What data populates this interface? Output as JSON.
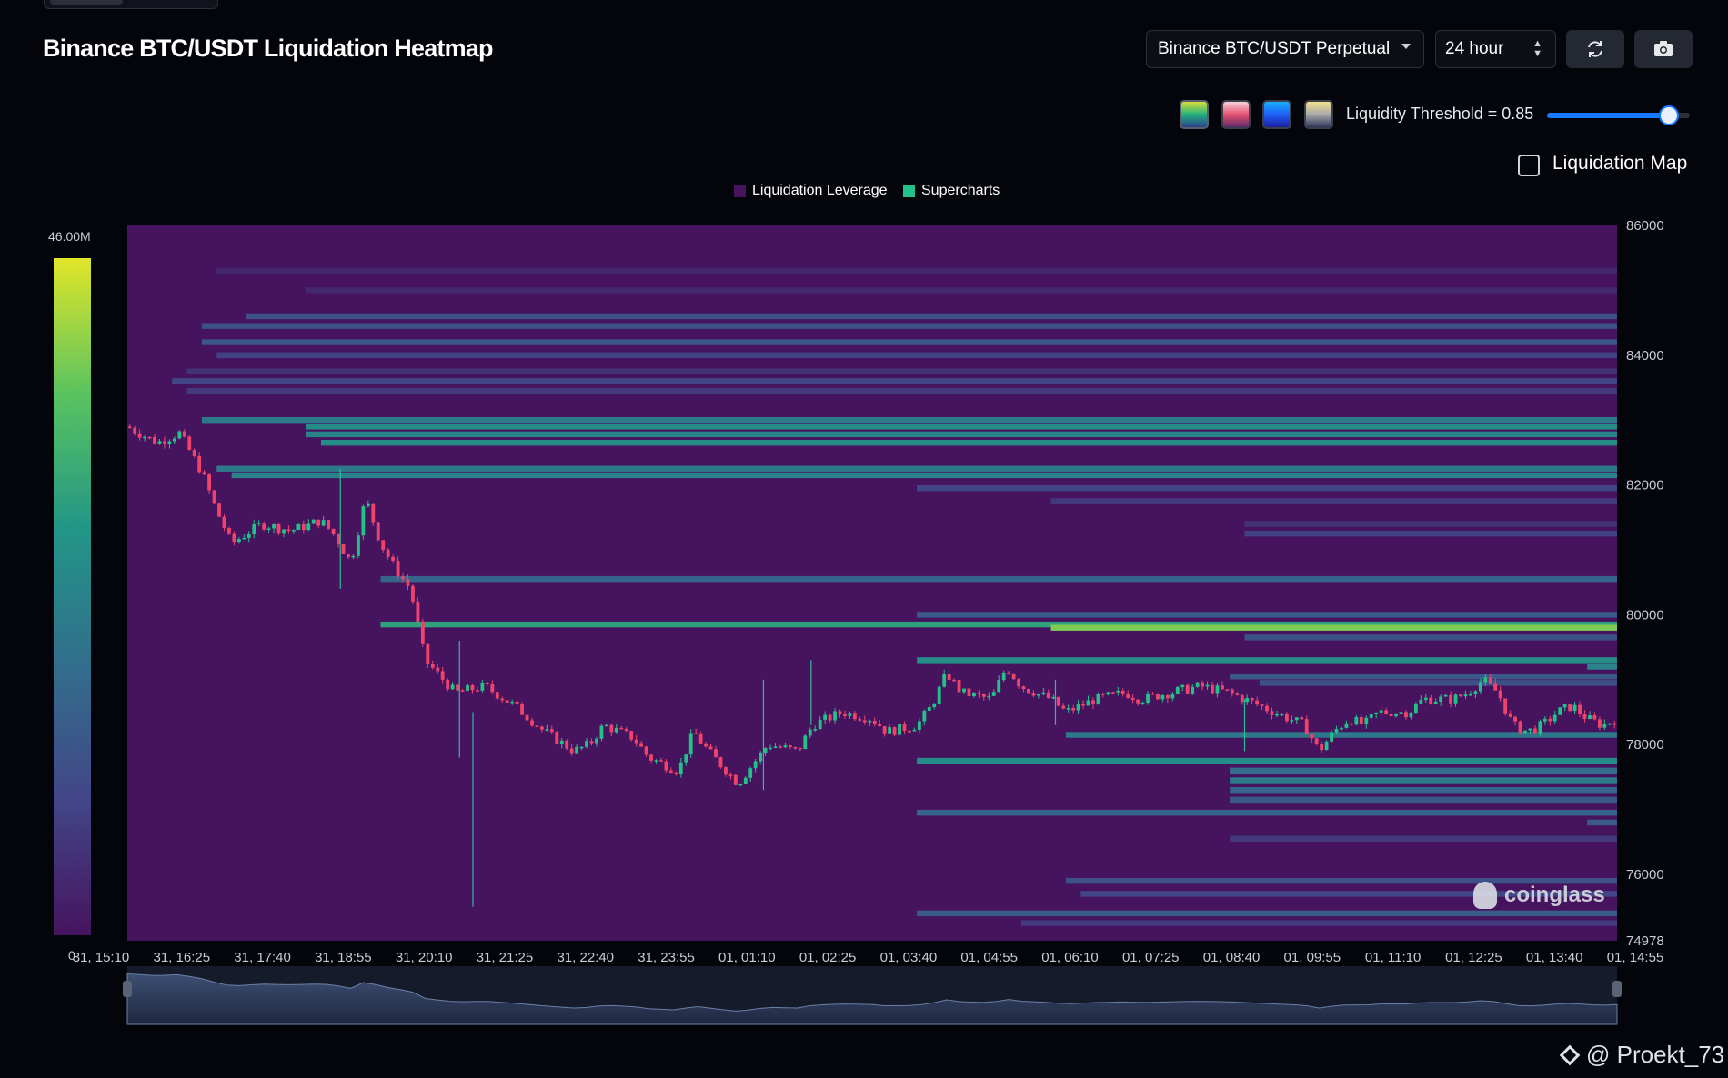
{
  "page": {
    "title": "Binance BTC/USDT Liquidation Heatmap"
  },
  "controls": {
    "pair_select": "Binance BTC/USDT Perpetual",
    "range_select": "24 hour",
    "refresh_icon": "refresh-icon",
    "camera_icon": "camera-icon",
    "threshold_label": "Liquidity Threshold = 0.85",
    "threshold_value": 0.85,
    "liquidation_map_label": "Liquidation Map",
    "liquidation_map_checked": false,
    "palettes": [
      "viridis",
      "pink",
      "blue",
      "yellow-gray"
    ]
  },
  "legend": {
    "item1": "Liquidation Leverage",
    "item2": "Supercharts"
  },
  "colorbar": {
    "max_label": "46.00M",
    "min_label": "0"
  },
  "watermark": "coinglass",
  "credit": "@ Proekt_73",
  "colors": {
    "background": "#03050b",
    "heatmap_base": "#46145f",
    "candle_up": "#23c18a",
    "candle_down": "#f0436b",
    "accent": "#1677ff"
  },
  "chart_data": {
    "type": "heatmap",
    "title": "Binance BTC/USDT Liquidation Heatmap",
    "y_axis": {
      "min": 74978,
      "max": 86000,
      "ticks": [
        86000,
        84000,
        82000,
        80000,
        78000,
        76000
      ],
      "bottom_label": "74978"
    },
    "x_axis": {
      "ticks": [
        "31, 15:10",
        "31, 16:25",
        "31, 17:40",
        "31, 18:55",
        "31, 20:10",
        "31, 21:25",
        "31, 22:40",
        "31, 23:55",
        "01, 01:10",
        "01, 02:25",
        "01, 03:40",
        "01, 04:55",
        "01, 06:10",
        "01, 07:25",
        "01, 08:40",
        "01, 09:55",
        "01, 11:10",
        "01, 12:25",
        "01, 13:40",
        "01, 14:55"
      ]
    },
    "colorbar_range": [
      0,
      46000000
    ],
    "liquidation_bands": [
      {
        "price": 85300,
        "start": 0.06,
        "intensity": 0.08
      },
      {
        "price": 85000,
        "start": 0.12,
        "intensity": 0.08
      },
      {
        "price": 84600,
        "start": 0.08,
        "intensity": 0.25
      },
      {
        "price": 84450,
        "start": 0.05,
        "intensity": 0.25
      },
      {
        "price": 84200,
        "start": 0.05,
        "intensity": 0.28
      },
      {
        "price": 84000,
        "start": 0.06,
        "intensity": 0.18
      },
      {
        "price": 83750,
        "start": 0.04,
        "intensity": 0.12
      },
      {
        "price": 83600,
        "start": 0.03,
        "intensity": 0.2
      },
      {
        "price": 83450,
        "start": 0.04,
        "intensity": 0.15
      },
      {
        "price": 83000,
        "start": 0.05,
        "intensity": 0.45
      },
      {
        "price": 82900,
        "start": 0.12,
        "intensity": 0.55
      },
      {
        "price": 82780,
        "start": 0.12,
        "intensity": 0.5
      },
      {
        "price": 82650,
        "start": 0.13,
        "intensity": 0.55
      },
      {
        "price": 82250,
        "start": 0.06,
        "intensity": 0.45
      },
      {
        "price": 82150,
        "start": 0.07,
        "intensity": 0.5
      },
      {
        "price": 81950,
        "start": 0.53,
        "intensity": 0.2
      },
      {
        "price": 81750,
        "start": 0.62,
        "intensity": 0.15
      },
      {
        "price": 81400,
        "start": 0.75,
        "intensity": 0.12
      },
      {
        "price": 81250,
        "start": 0.75,
        "intensity": 0.18
      },
      {
        "price": 80550,
        "start": 0.17,
        "intensity": 0.35
      },
      {
        "price": 80000,
        "start": 0.53,
        "intensity": 0.3
      },
      {
        "price": 79850,
        "start": 0.17,
        "intensity": 0.65
      },
      {
        "price": 79800,
        "start": 0.62,
        "intensity": 0.85
      },
      {
        "price": 79650,
        "start": 0.75,
        "intensity": 0.25
      },
      {
        "price": 79300,
        "start": 0.53,
        "intensity": 0.55
      },
      {
        "price": 79200,
        "start": 0.98,
        "intensity": 0.5
      },
      {
        "price": 79050,
        "start": 0.74,
        "intensity": 0.3
      },
      {
        "price": 78950,
        "start": 0.76,
        "intensity": 0.25
      },
      {
        "price": 78150,
        "start": 0.63,
        "intensity": 0.45
      },
      {
        "price": 77750,
        "start": 0.53,
        "intensity": 0.55
      },
      {
        "price": 77600,
        "start": 0.74,
        "intensity": 0.4
      },
      {
        "price": 77450,
        "start": 0.74,
        "intensity": 0.45
      },
      {
        "price": 77300,
        "start": 0.74,
        "intensity": 0.35
      },
      {
        "price": 77150,
        "start": 0.74,
        "intensity": 0.3
      },
      {
        "price": 76950,
        "start": 0.53,
        "intensity": 0.35
      },
      {
        "price": 76800,
        "start": 0.98,
        "intensity": 0.3
      },
      {
        "price": 76550,
        "start": 0.74,
        "intensity": 0.15
      },
      {
        "price": 75900,
        "start": 0.63,
        "intensity": 0.25
      },
      {
        "price": 75700,
        "start": 0.64,
        "intensity": 0.2
      },
      {
        "price": 75400,
        "start": 0.53,
        "intensity": 0.3
      },
      {
        "price": 75250,
        "start": 0.6,
        "intensity": 0.15
      }
    ],
    "price_path": [
      [
        0,
        82900
      ],
      [
        0.02,
        82650
      ],
      [
        0.035,
        82800
      ],
      [
        0.05,
        82200
      ],
      [
        0.06,
        81600
      ],
      [
        0.07,
        81100
      ],
      [
        0.09,
        81400
      ],
      [
        0.11,
        81300
      ],
      [
        0.13,
        81450
      ],
      [
        0.14,
        81200
      ],
      [
        0.15,
        80800
      ],
      [
        0.16,
        81800
      ],
      [
        0.17,
        81100
      ],
      [
        0.18,
        80700
      ],
      [
        0.19,
        80400
      ],
      [
        0.2,
        79300
      ],
      [
        0.22,
        78800
      ],
      [
        0.24,
        78900
      ],
      [
        0.26,
        78600
      ],
      [
        0.28,
        78200
      ],
      [
        0.3,
        77900
      ],
      [
        0.31,
        78000
      ],
      [
        0.32,
        78300
      ],
      [
        0.34,
        78100
      ],
      [
        0.35,
        77800
      ],
      [
        0.37,
        77600
      ],
      [
        0.38,
        78200
      ],
      [
        0.39,
        77900
      ],
      [
        0.41,
        77400
      ],
      [
        0.42,
        77700
      ],
      [
        0.43,
        78000
      ],
      [
        0.45,
        77900
      ],
      [
        0.46,
        78300
      ],
      [
        0.48,
        78500
      ],
      [
        0.5,
        78400
      ],
      [
        0.51,
        78200
      ],
      [
        0.53,
        78300
      ],
      [
        0.54,
        78600
      ],
      [
        0.55,
        79100
      ],
      [
        0.56,
        78800
      ],
      [
        0.58,
        78700
      ],
      [
        0.59,
        79200
      ],
      [
        0.6,
        78900
      ],
      [
        0.62,
        78700
      ],
      [
        0.63,
        78500
      ],
      [
        0.65,
        78700
      ],
      [
        0.67,
        78800
      ],
      [
        0.68,
        78700
      ],
      [
        0.7,
        78800
      ],
      [
        0.72,
        78900
      ],
      [
        0.74,
        78800
      ],
      [
        0.75,
        78700
      ],
      [
        0.77,
        78500
      ],
      [
        0.78,
        78400
      ],
      [
        0.79,
        78300
      ],
      [
        0.8,
        77900
      ],
      [
        0.81,
        78200
      ],
      [
        0.82,
        78400
      ],
      [
        0.83,
        78300
      ],
      [
        0.84,
        78500
      ],
      [
        0.86,
        78500
      ],
      [
        0.87,
        78700
      ],
      [
        0.89,
        78700
      ],
      [
        0.9,
        78800
      ],
      [
        0.91,
        79000
      ],
      [
        0.92,
        78800
      ],
      [
        0.93,
        78300
      ],
      [
        0.94,
        78200
      ],
      [
        0.95,
        78300
      ],
      [
        0.96,
        78500
      ],
      [
        0.97,
        78600
      ],
      [
        0.98,
        78400
      ],
      [
        0.99,
        78300
      ],
      [
        1.0,
        78400
      ]
    ],
    "candle_spikes": [
      {
        "t": 0.143,
        "low": 80400,
        "high": 82250
      },
      {
        "t": 0.223,
        "low": 77800,
        "high": 79600
      },
      {
        "t": 0.232,
        "low": 75500,
        "high": 78500
      },
      {
        "t": 0.427,
        "low": 77300,
        "high": 79000
      },
      {
        "t": 0.459,
        "low": 78300,
        "high": 79300
      },
      {
        "t": 0.623,
        "low": 78300,
        "high": 79000
      },
      {
        "t": 0.75,
        "low": 77900,
        "high": 78700
      }
    ]
  }
}
